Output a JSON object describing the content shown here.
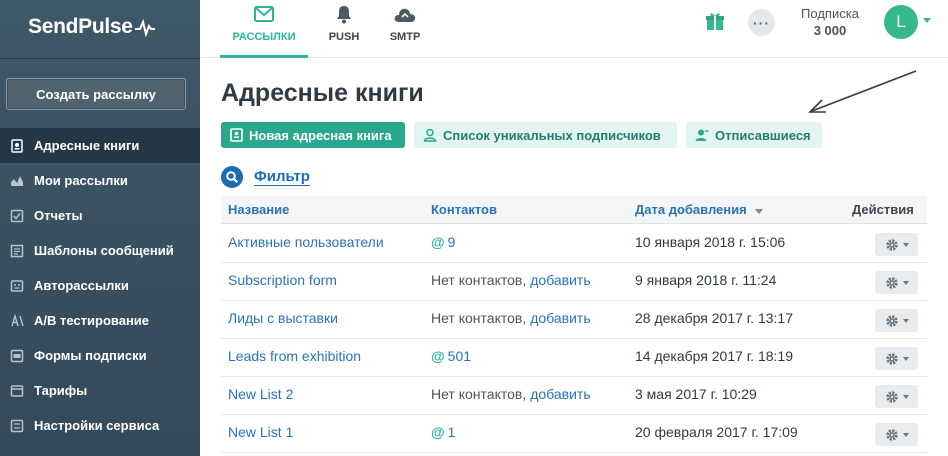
{
  "brand": {
    "name": "SendPulse"
  },
  "sidebar": {
    "create_label": "Создать рассылку",
    "items": [
      {
        "label": "Адресные книги",
        "icon": "address-book-icon",
        "active": true
      },
      {
        "label": "Мои рассылки",
        "icon": "mailings-icon"
      },
      {
        "label": "Отчеты",
        "icon": "reports-icon"
      },
      {
        "label": "Шаблоны сообщений",
        "icon": "templates-icon"
      },
      {
        "label": "Авторассылки",
        "icon": "automation-icon"
      },
      {
        "label": "А/В тестирование",
        "icon": "ab-test-icon"
      },
      {
        "label": "Формы подписки",
        "icon": "forms-icon"
      },
      {
        "label": "Тарифы",
        "icon": "pricing-icon"
      },
      {
        "label": "Настройки сервиса",
        "icon": "settings-icon"
      }
    ]
  },
  "topbar": {
    "tabs": [
      {
        "label": "РАССЫЛКИ",
        "icon": "envelope-icon",
        "active": true
      },
      {
        "label": "PUSH",
        "icon": "bell-icon"
      },
      {
        "label": "SMTP",
        "icon": "cloud-icon"
      }
    ],
    "more_label": "···",
    "subscription_label": "Подписка",
    "subscription_count": "3 000",
    "avatar_letter": "L"
  },
  "main": {
    "title": "Адресные книги",
    "buttons": {
      "new_book": "Новая адресная книга",
      "unique_subscribers": "Список уникальных подписчиков",
      "unsubscribed": "Отписавшиеся"
    },
    "filter_label": "Фильтр",
    "table": {
      "headers": {
        "name": "Название",
        "contacts": "Контактов",
        "date": "Дата добавления",
        "actions": "Действия"
      },
      "rows": [
        {
          "name": "Активные пользователи",
          "contacts": "9",
          "empty": "",
          "add": "",
          "date": "10 января 2018 г. 15:06"
        },
        {
          "name": "Subscription form",
          "contacts": "",
          "empty": "Нет контактов,",
          "add": "добавить",
          "date": "9 января 2018 г. 11:24"
        },
        {
          "name": "Лиды с выставки",
          "contacts": "",
          "empty": "Нет контактов,",
          "add": "добавить",
          "date": "28 декабря 2017 г. 13:17"
        },
        {
          "name": "Leads from exhibition",
          "contacts": "501",
          "empty": "",
          "add": "",
          "date": "14 декабря 2017 г. 18:19"
        },
        {
          "name": "New List 2",
          "contacts": "",
          "empty": "Нет контактов,",
          "add": "добавить",
          "date": "3 мая 2017 г. 10:29"
        },
        {
          "name": "New List 1",
          "contacts": "1",
          "empty": "",
          "add": "",
          "date": "20 февраля 2017 г. 17:09"
        }
      ]
    }
  },
  "colors": {
    "accent": "#2aa88e",
    "link": "#2a73b8",
    "sidebar": "#3f5868"
  }
}
